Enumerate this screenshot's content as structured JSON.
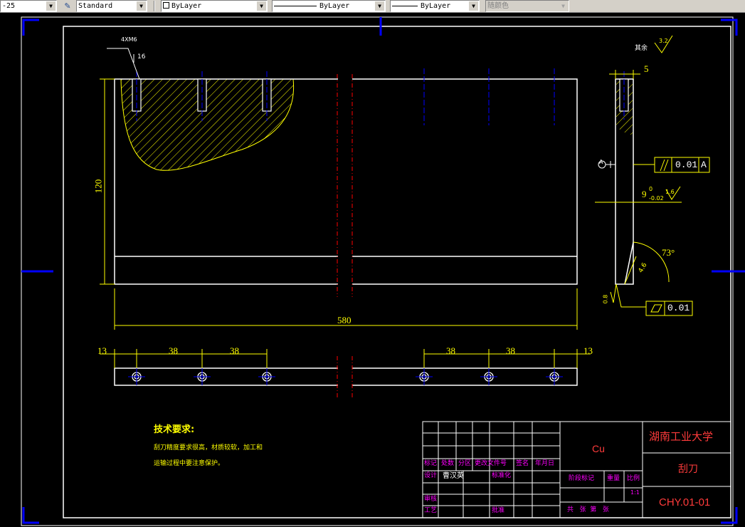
{
  "toolbar": {
    "linetype_scale": "-25",
    "text_style": "Standard",
    "layer": "ByLayer",
    "linetype": "ByLayer",
    "lineweight": "ByLayer",
    "color": "随颜色"
  },
  "drawing": {
    "thread_note": "4XM6",
    "thread_depth": "16",
    "dim_height": "120",
    "dim_length": "580",
    "dim_thickness": "5",
    "dim_bevel_angle": "73°",
    "dim_bevel_len": "4.6",
    "dim_width_main": "9",
    "dim_width_tol_upper": "0",
    "dim_width_tol_lower": "-0.02",
    "rough_other_label": "其余",
    "rough_other_value": "3.2",
    "rough_side_value": "1.6",
    "rough_edge_value": "0.8",
    "datum_label": "A",
    "tol_parallel_value": "0.01",
    "tol_parallel_datum": "A",
    "tol_flat_value": "0.01",
    "spacing": [
      "13",
      "38",
      "38",
      "38",
      "38",
      "13"
    ],
    "tech_req_title": "技术要求:",
    "tech_req_line1": "刮刀精度要求很高，材质较软，加工和",
    "tech_req_line2": "运输过程中要注意保护。"
  },
  "title_block": {
    "material": "Cu",
    "school": "湖南工业大学",
    "part_name": "刮刀",
    "drawing_number": "CHY.01-01",
    "scale": "1:1",
    "header": [
      "标记",
      "处数",
      "分区",
      "更改文件号",
      "签名",
      "年月日"
    ],
    "design_label": "设计",
    "designer": "曹汉英",
    "standardize_label": "标准化",
    "stage_mark_label": "阶段标记",
    "weight_label": "重量",
    "ratio_label": "比例",
    "review_label": "审核",
    "process_label": "工艺",
    "approve_label": "批准",
    "sheets_label": "共   张  第   张"
  },
  "colors": {
    "background": "#000000",
    "outline": "#ffffff",
    "dimension": "#ffff00",
    "centerline": "#0000ff",
    "breakline": "#ff0000",
    "frame_corner": "#0000ff",
    "title_text": "#ff00ff"
  }
}
